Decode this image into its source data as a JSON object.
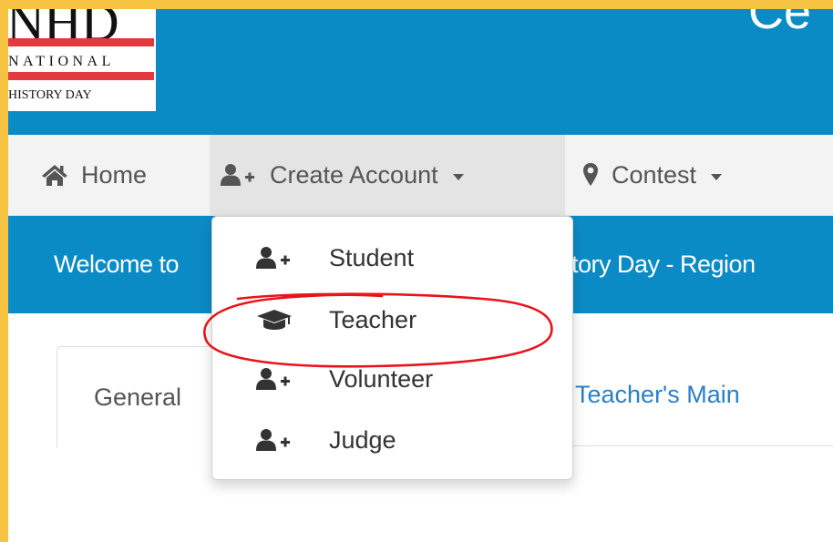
{
  "header": {
    "logo": {
      "top": "NHD",
      "line2": "NATIONAL",
      "line3": "HISTORY DAY"
    },
    "title": "Ce"
  },
  "nav": {
    "home": "Home",
    "create_account": "Create Account",
    "contest": "Contest"
  },
  "dropdown": {
    "items": [
      {
        "label": "Student",
        "icon": "user-plus-icon"
      },
      {
        "label": "Teacher",
        "icon": "graduation-cap-icon"
      },
      {
        "label": "Volunteer",
        "icon": "user-plus-icon"
      },
      {
        "label": "Judge",
        "icon": "user-plus-icon"
      }
    ]
  },
  "welcome": {
    "left": "Welcome to",
    "right": "story Day - Region"
  },
  "tabs": {
    "general": "General",
    "teacher_main": "Teacher's Main"
  },
  "colors": {
    "header_blue": "#0b8bc6",
    "frame": "#f5c242",
    "annotation": "#e8141b",
    "link": "#2a80c5"
  }
}
